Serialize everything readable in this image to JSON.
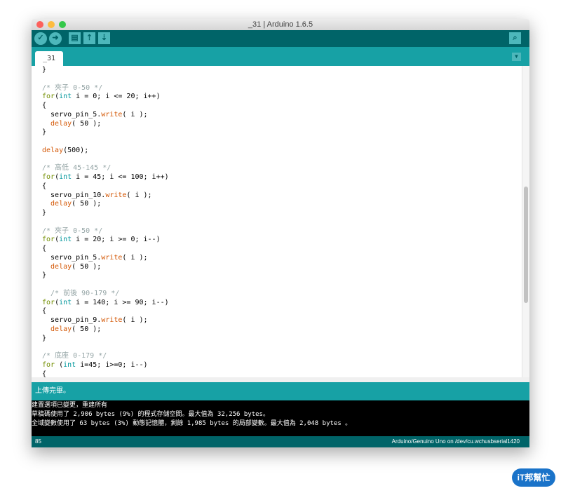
{
  "window": {
    "title": "_31 | Arduino 1.6.5"
  },
  "toolbar": {
    "verify": "verify-icon",
    "upload": "upload-icon",
    "new": "new-icon",
    "open": "open-icon",
    "save": "save-icon",
    "serial_monitor": "magnifier-icon"
  },
  "tabs": [
    {
      "label": "_31"
    }
  ],
  "code_lines": [
    "}",
    "",
    "/* 夾子 0-50 */",
    "for(int i = 0; i <= 20; i++)",
    "{",
    "  servo_pin_5.write( i );",
    "  delay( 50 );",
    "}",
    "",
    "delay(500);",
    "",
    "/* 高低 45-145 */",
    "for(int i = 45; i <= 100; i++)",
    "{",
    "  servo_pin_10.write( i );",
    "  delay( 50 );",
    "}",
    "",
    "/* 夾子 0-50 */",
    "for(int i = 20; i >= 0; i--)",
    "{",
    "  servo_pin_5.write( i );",
    "  delay( 50 );",
    "}",
    "",
    "  /* 前後 90-179 */",
    "for(int i = 140; i >= 90; i--)",
    "{",
    "  servo_pin_9.write( i );",
    "  delay( 50 );",
    "}",
    "",
    "/* 底座 0-179 */",
    "for (int i=45; i>=0; i--)",
    "{"
  ],
  "status": "上傳完畢。",
  "console": [
    "建置選項已變更，重建所有",
    "草稿碼使用了 2,906 bytes (9%) 的程式存儲空間。最大值為 32,256 bytes。",
    "全域變數使用了 63 bytes (3%) 動態記憶體，剩餘 1,985 bytes 的局部變數。最大值為 2,048 bytes 。"
  ],
  "footer": {
    "line": "85",
    "board": "Arduino/Genuino Uno on /dev/cu.wchusbserial1420"
  },
  "watermark": "iT邦幫忙",
  "colors": {
    "toolbar": "#006468",
    "tabbar": "#17a1a5",
    "keyword": "#728e00",
    "type": "#00979c",
    "function": "#d35400",
    "comment": "#95a5a6"
  }
}
